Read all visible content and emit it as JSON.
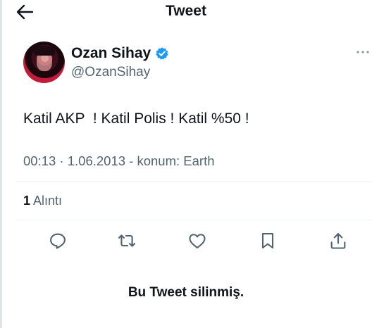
{
  "header": {
    "title": "Tweet",
    "back_icon": "arrow-left-icon"
  },
  "author": {
    "display_name": "Ozan Sihay",
    "handle": "@OzanSihay",
    "verified_icon": "verified-badge-icon",
    "verified_color": "#1d9bf0"
  },
  "tweet": {
    "text": "Katil AKP  ! Katil Polis ! Katil %50 !",
    "meta": "00:13 · 1.06.2013 - konum: Earth"
  },
  "stats": {
    "quote_count": "1",
    "quote_label": "Alıntı"
  },
  "actions": [
    "reply-icon",
    "retweet-icon",
    "like-icon",
    "bookmark-icon",
    "share-icon"
  ],
  "footer": {
    "deleted_notice": "Bu Tweet silinmiş."
  },
  "colors": {
    "text": "#0f1419",
    "secondary": "#536471",
    "divider": "#eff3f4"
  }
}
